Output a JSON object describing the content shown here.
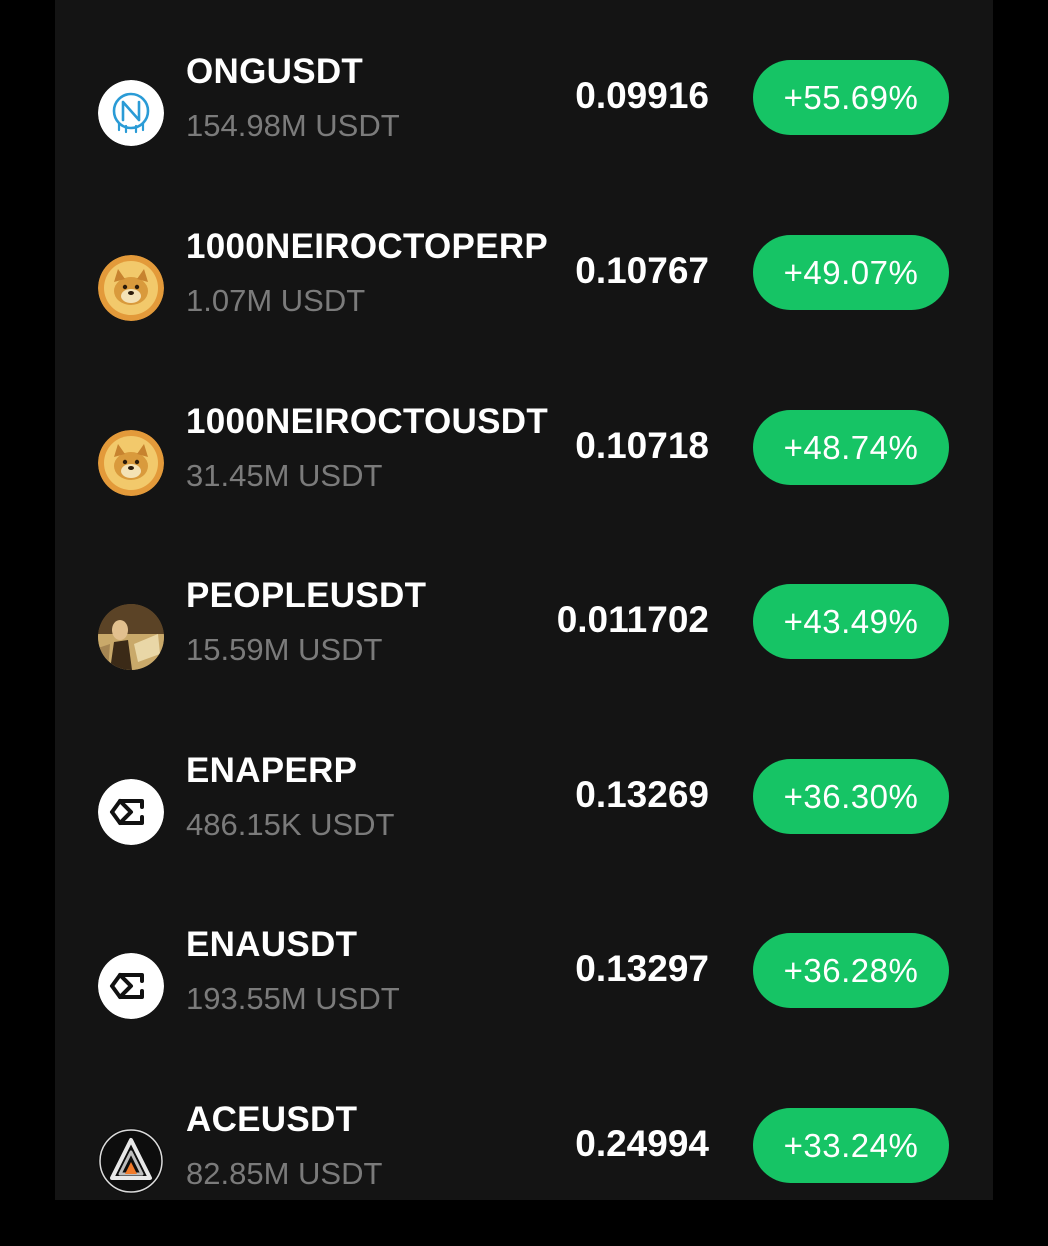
{
  "colors": {
    "background": "#141414",
    "outer": "#000000",
    "positive": "#16c465",
    "primary_text": "#ffffff",
    "secondary_text": "#7b7b7b"
  },
  "markets": [
    {
      "symbol": "ONGUSDT",
      "volume": "154.98M USDT",
      "price": "0.09916",
      "change": "+55.69%",
      "icon": "ont-gas-icon"
    },
    {
      "symbol": "1000NEIROCTOPERP",
      "volume": "1.07M USDT",
      "price": "0.10767",
      "change": "+49.07%",
      "icon": "neiro-dog-icon"
    },
    {
      "symbol": "1000NEIROCTOUSDT",
      "volume": "31.45M USDT",
      "price": "0.10718",
      "change": "+48.74%",
      "icon": "neiro-dog-icon"
    },
    {
      "symbol": "PEOPLEUSDT",
      "volume": "15.59M USDT",
      "price": "0.011702",
      "change": "+43.49%",
      "icon": "people-portrait-icon"
    },
    {
      "symbol": "ENAPERP",
      "volume": "486.15K USDT",
      "price": "0.13269",
      "change": "+36.30%",
      "icon": "ethena-icon"
    },
    {
      "symbol": "ENAUSDT",
      "volume": "193.55M USDT",
      "price": "0.13297",
      "change": "+36.28%",
      "icon": "ethena-icon"
    },
    {
      "symbol": "ACEUSDT",
      "volume": "82.85M USDT",
      "price": "0.24994",
      "change": "+33.24%",
      "icon": "ace-triangle-icon"
    }
  ]
}
